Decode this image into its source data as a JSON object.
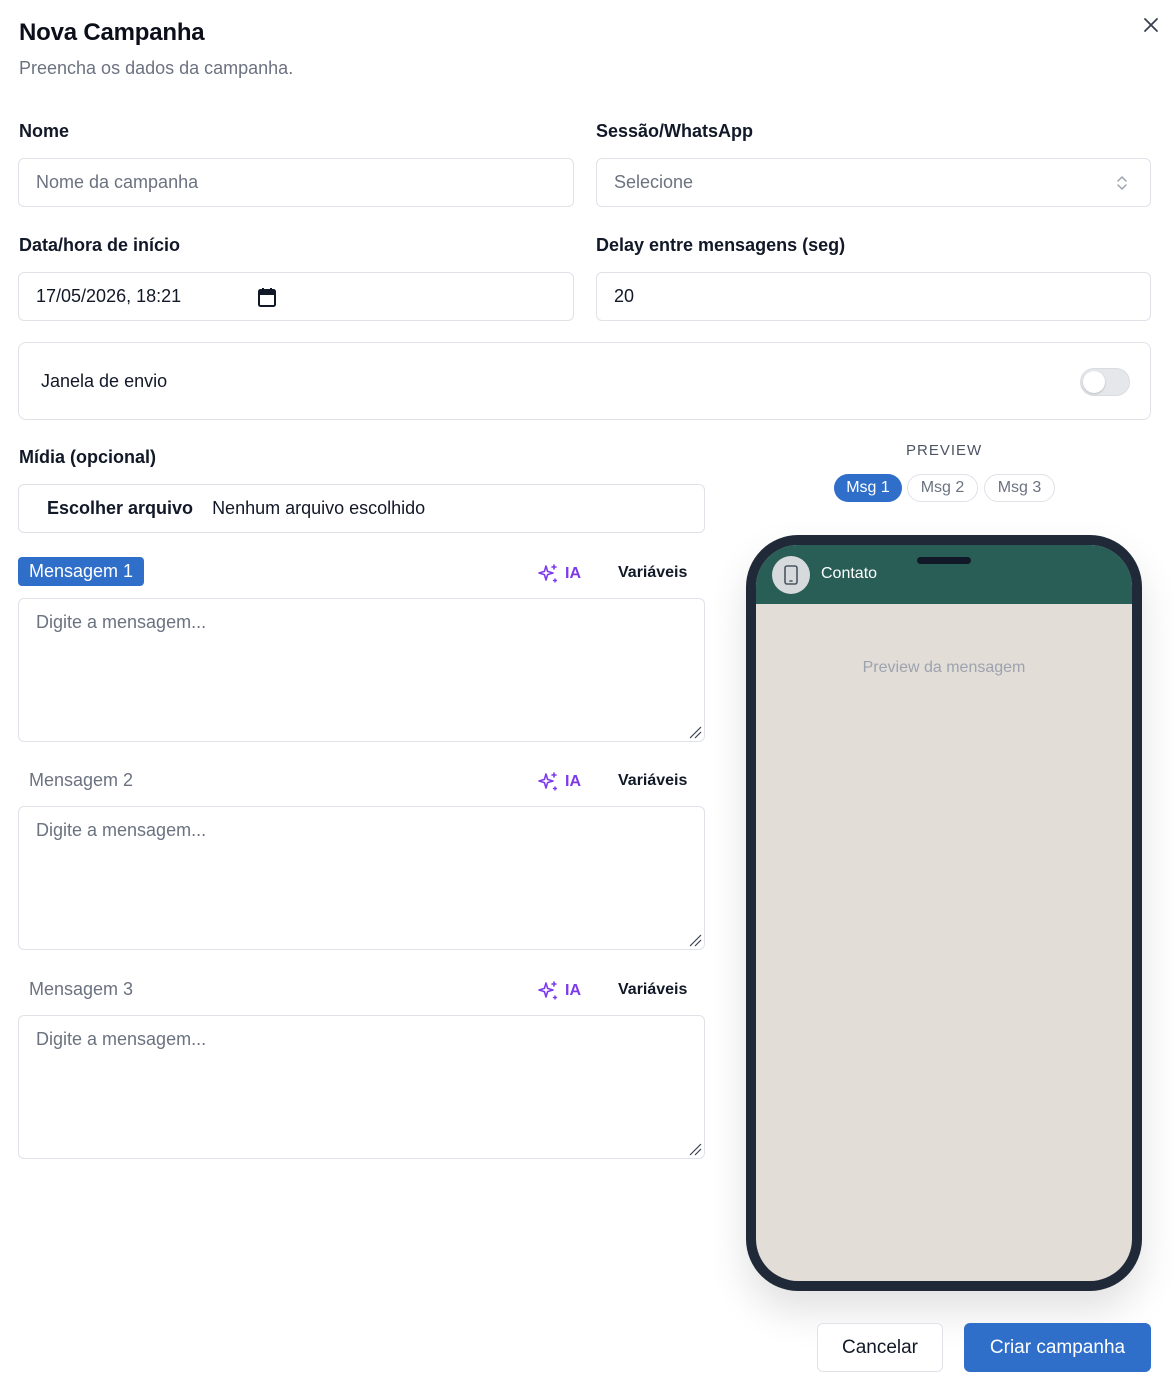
{
  "dialog": {
    "title": "Nova Campanha",
    "subtitle": "Preencha os dados da campanha."
  },
  "form": {
    "name": {
      "label": "Nome",
      "placeholder": "Nome da campanha",
      "value": ""
    },
    "session": {
      "label": "Sessão/WhatsApp",
      "selected": "Selecione"
    },
    "start": {
      "label": "Data/hora de início",
      "value": "17/05/2026, 18:21"
    },
    "delay": {
      "label": "Delay entre mensagens (seg)",
      "value": "20"
    },
    "send_window": {
      "label": "Janela de envio",
      "enabled": false
    },
    "media": {
      "label": "Mídia (opcional)",
      "button": "Escolher arquivo",
      "status": "Nenhum arquivo escolhido"
    },
    "messages": [
      {
        "label": "Mensagem 1",
        "ia": "IA",
        "variables": "Variáveis",
        "placeholder": "Digite a mensagem...",
        "active": true
      },
      {
        "label": "Mensagem 2",
        "ia": "IA",
        "variables": "Variáveis",
        "placeholder": "Digite a mensagem...",
        "active": false
      },
      {
        "label": "Mensagem 3",
        "ia": "IA",
        "variables": "Variáveis",
        "placeholder": "Digite a mensagem...",
        "active": false
      }
    ]
  },
  "preview": {
    "label": "PREVIEW",
    "tabs": [
      "Msg 1",
      "Msg 2",
      "Msg 3"
    ],
    "active_tab": "Msg 1",
    "contact": "Contato",
    "placeholder": "Preview da mensagem",
    "header_color": "#285e55",
    "chat_bg_color": "#e3ddd7"
  },
  "footer": {
    "cancel": "Cancelar",
    "submit": "Criar campanha"
  },
  "colors": {
    "primary": "#2f6fca",
    "ai_accent": "#7c3aed"
  },
  "icons": {
    "close": "close-icon",
    "select": "chevron-up-down-icon",
    "calendar": "calendar-icon",
    "ai": "sparkles-icon",
    "avatar": "smartphone-icon",
    "resize": "resize-handle-icon"
  }
}
